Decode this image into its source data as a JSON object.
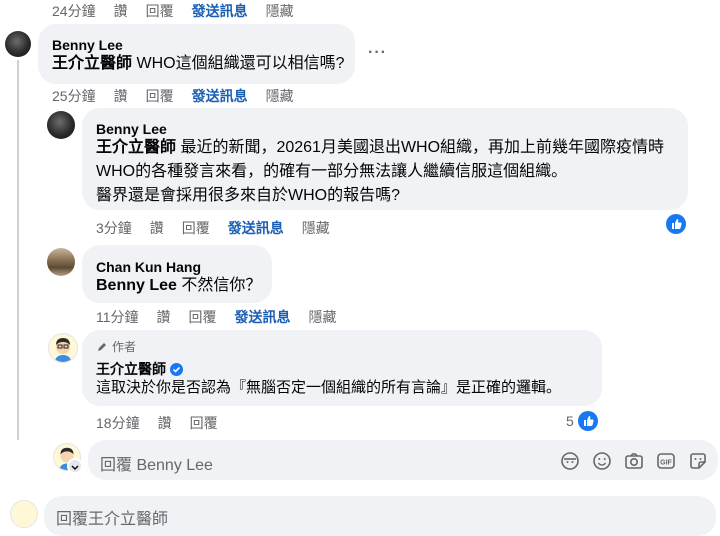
{
  "top_actions": {
    "time": "24分鐘",
    "like": "讚",
    "reply": "回覆",
    "send": "發送訊息",
    "hide": "隱藏"
  },
  "comments": [
    {
      "author": "Benny Lee",
      "mention": "王介立醫師",
      "text": " WHO這個組織還可以相信嗎?",
      "actions": {
        "time": "25分鐘",
        "like": "讚",
        "reply": "回覆",
        "send": "發送訊息",
        "hide": "隱藏"
      },
      "more": "···"
    },
    {
      "author": "Benny Lee",
      "mention": "王介立醫師",
      "line1": " 最近的新聞，20261月美國退出WHO組織，再加上前幾年國際疫情時",
      "line2": "WHO的各種發言來看，的確有一部分無法讓人繼續信服這個組織。",
      "line3": "醫界還是會採用很多來自於WHO的報告嗎?",
      "actions": {
        "time": "3分鐘",
        "like": "讚",
        "reply": "回覆",
        "send": "發送訊息",
        "hide": "隱藏"
      }
    },
    {
      "author": "Chan Kun Hang",
      "mention": "Benny Lee",
      "text": " 不然信你？",
      "actions": {
        "time": "11分鐘",
        "like": "讚",
        "reply": "回覆",
        "send": "發送訊息",
        "hide": "隱藏"
      }
    },
    {
      "badge": "作者",
      "author": "王介立醫師",
      "text": "這取決於你是否認為『無腦否定一個組織的所有言論』是正確的邏輯。",
      "actions": {
        "time": "18分鐘",
        "like": "讚",
        "reply": "回覆"
      },
      "reaction_count": "5"
    }
  ],
  "reply_box": {
    "placeholder": "回覆 Benny Lee"
  },
  "bottom_reply_box": {
    "placeholder": "回覆王介立醫師"
  },
  "colors": {
    "bubble": "#f0f2f5",
    "blue": "#1877f2",
    "gray_text": "#65676b",
    "link": "#1b5fb5"
  }
}
